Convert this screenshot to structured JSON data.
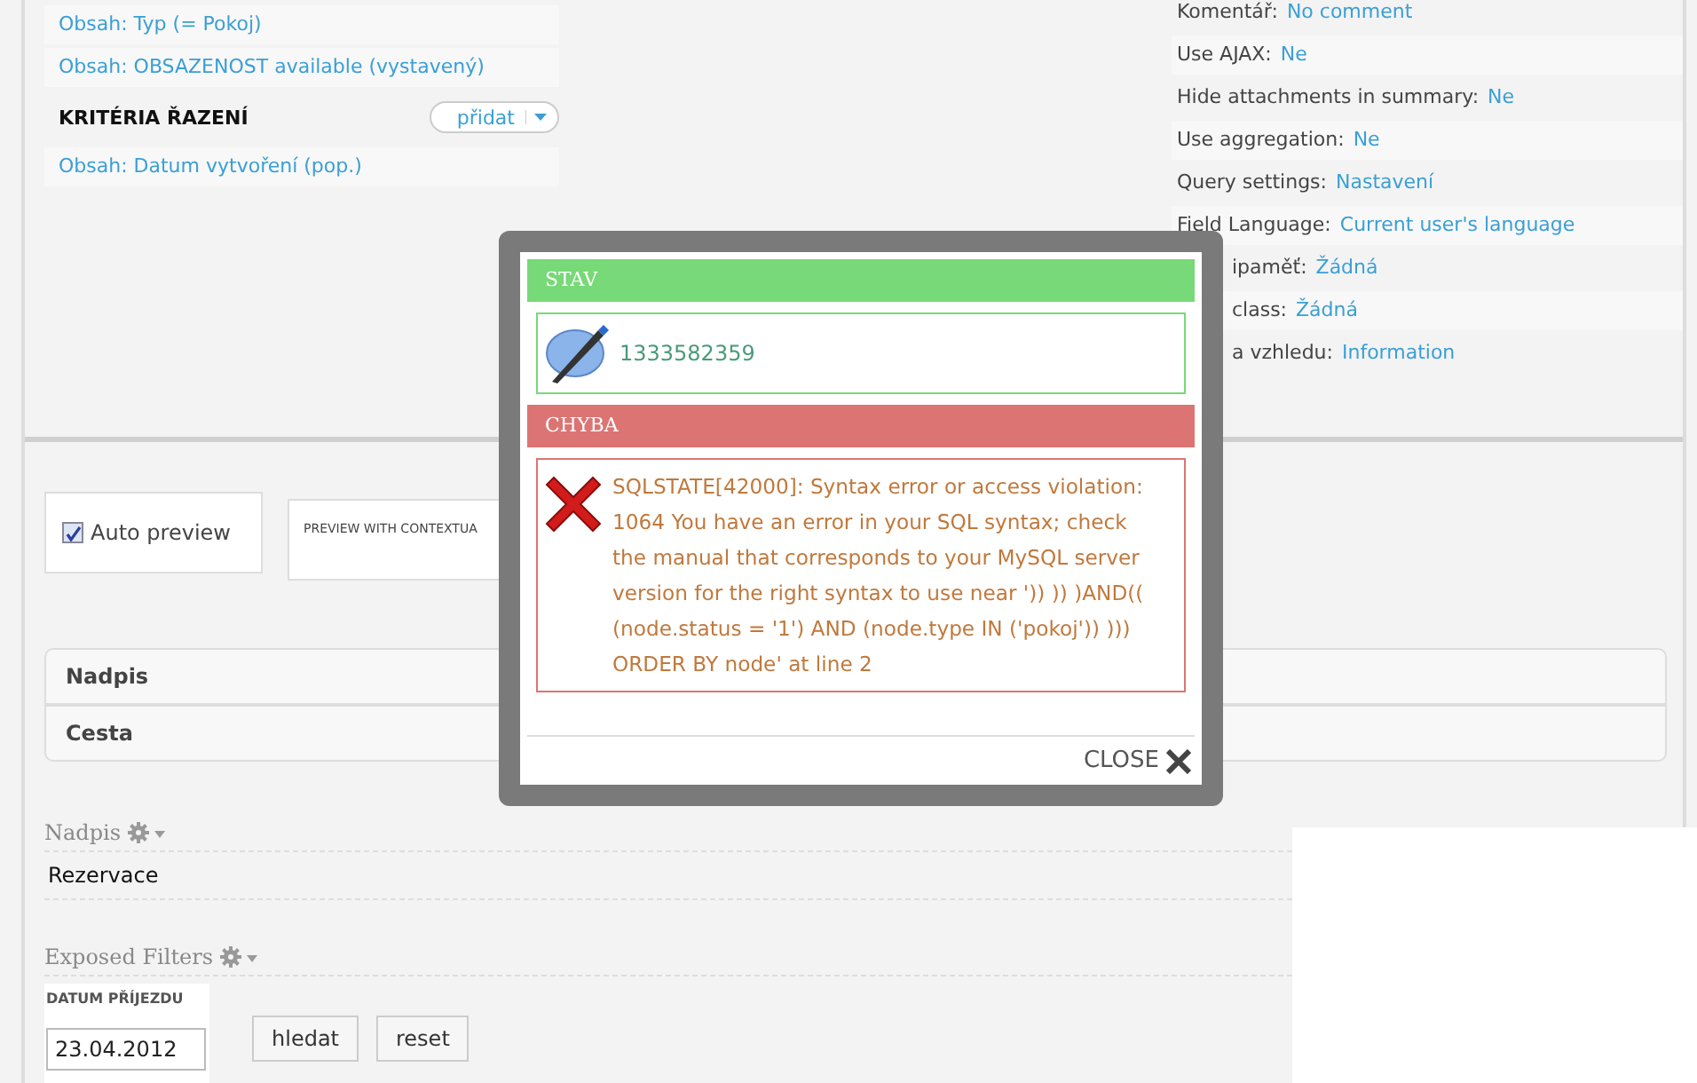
{
  "filter_items": [
    "Obsah: Typ (= Pokoj)",
    "Obsah: OBSAZENOST available (vystavený)"
  ],
  "sort_section": {
    "title": "KRITÉRIA ŘAZENÍ",
    "add_button": "přidat",
    "items": [
      "Obsah: Datum vytvoření (pop.)"
    ]
  },
  "settings": [
    {
      "label": "Komentář:",
      "value": "No comment",
      "covered": false
    },
    {
      "label": "Use AJAX:",
      "value": "Ne",
      "covered": false
    },
    {
      "label": "Hide attachments in summary:",
      "value": "Ne",
      "covered": false
    },
    {
      "label": "Use aggregation:",
      "value": "Ne",
      "covered": false
    },
    {
      "label": "Query settings:",
      "value": "Nastavení",
      "covered": false
    },
    {
      "label": "Field Language:",
      "value": "Current user's language",
      "covered": false
    },
    {
      "label": "ipaměť:",
      "value": "Žádná",
      "covered": true
    },
    {
      "label": "class:",
      "value": "Žádná",
      "covered": true
    },
    {
      "label": "a vzhledu:",
      "value": "Information",
      "covered": true
    }
  ],
  "preview": {
    "auto_preview": {
      "label": "Auto preview",
      "checked": true
    },
    "contextual_label": "PREVIEW WITH CONTEXTUA"
  },
  "table_rows": [
    "Nadpis",
    "Cesta"
  ],
  "title_section": {
    "heading": "Nadpis",
    "value": "Rezervace"
  },
  "exposed_filters": {
    "heading": "Exposed Filters",
    "field_label": "DATUM PŘÍJEZDU",
    "field_value": "23.04.2012",
    "buttons": [
      "hledat",
      "reset"
    ]
  },
  "modal": {
    "status_heading": "STAV",
    "status_message": "1333582359",
    "error_heading": "CHYBA",
    "error_message": "SQLSTATE[42000]: Syntax error or access violation: 1064 You have an error in your SQL syntax; check the manual that corresponds to your MySQL server version for the right syntax to use near ')) ))  )AND(( (node.status = '1') AND (node.type IN ('pokoj')) ))) ORDER BY node' at line 2",
    "close": "CLOSE"
  }
}
